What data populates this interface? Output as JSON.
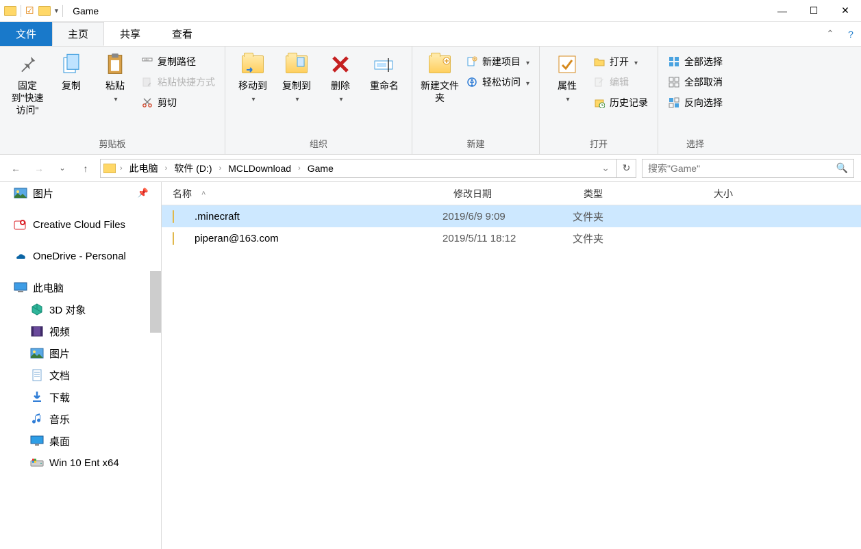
{
  "window": {
    "title": "Game"
  },
  "tabs": {
    "file": "文件",
    "home": "主页",
    "share": "共享",
    "view": "查看"
  },
  "ribbon": {
    "clipboard": {
      "label": "剪贴板",
      "pin": "固定到\"快速访问\"",
      "copy": "复制",
      "paste": "粘贴",
      "copy_path": "复制路径",
      "paste_shortcut": "粘贴快捷方式",
      "cut": "剪切"
    },
    "organize": {
      "label": "组织",
      "move_to": "移动到",
      "copy_to": "复制到",
      "delete": "删除",
      "rename": "重命名"
    },
    "new": {
      "label": "新建",
      "new_folder": "新建文件夹",
      "new_item": "新建项目",
      "easy_access": "轻松访问"
    },
    "open": {
      "label": "打开",
      "properties": "属性",
      "open": "打开",
      "edit": "编辑",
      "history": "历史记录"
    },
    "select": {
      "label": "选择",
      "select_all": "全部选择",
      "select_none": "全部取消",
      "invert": "反向选择"
    }
  },
  "breadcrumb": [
    "此电脑",
    "软件 (D:)",
    "MCLDownload",
    "Game"
  ],
  "search": {
    "placeholder": "搜索\"Game\""
  },
  "columns": {
    "name": "名称",
    "date": "修改日期",
    "type": "类型",
    "size": "大小"
  },
  "files": [
    {
      "name": ".minecraft",
      "date": "2019/6/9 9:09",
      "type": "文件夹",
      "selected": true
    },
    {
      "name": "piperan@163.com",
      "date": "2019/5/11 18:12",
      "type": "文件夹",
      "selected": false
    }
  ],
  "sidebar": [
    {
      "label": "图片",
      "icon": "pictures",
      "pinned": true,
      "indent": 0
    },
    {
      "label": "Creative Cloud Files",
      "icon": "cc",
      "indent": 0,
      "gap": true
    },
    {
      "label": "OneDrive - Personal",
      "icon": "onedrive",
      "indent": 0,
      "gap": true
    },
    {
      "label": "此电脑",
      "icon": "pc",
      "indent": 0,
      "gap": true
    },
    {
      "label": "3D 对象",
      "icon": "3d",
      "indent": 1
    },
    {
      "label": "视频",
      "icon": "video",
      "indent": 1
    },
    {
      "label": "图片",
      "icon": "pictures",
      "indent": 1
    },
    {
      "label": "文档",
      "icon": "doc",
      "indent": 1
    },
    {
      "label": "下载",
      "icon": "download",
      "indent": 1
    },
    {
      "label": "音乐",
      "icon": "music",
      "indent": 1
    },
    {
      "label": "桌面",
      "icon": "desktop",
      "indent": 1
    },
    {
      "label": "Win 10 Ent x64",
      "icon": "drive",
      "indent": 1
    }
  ]
}
